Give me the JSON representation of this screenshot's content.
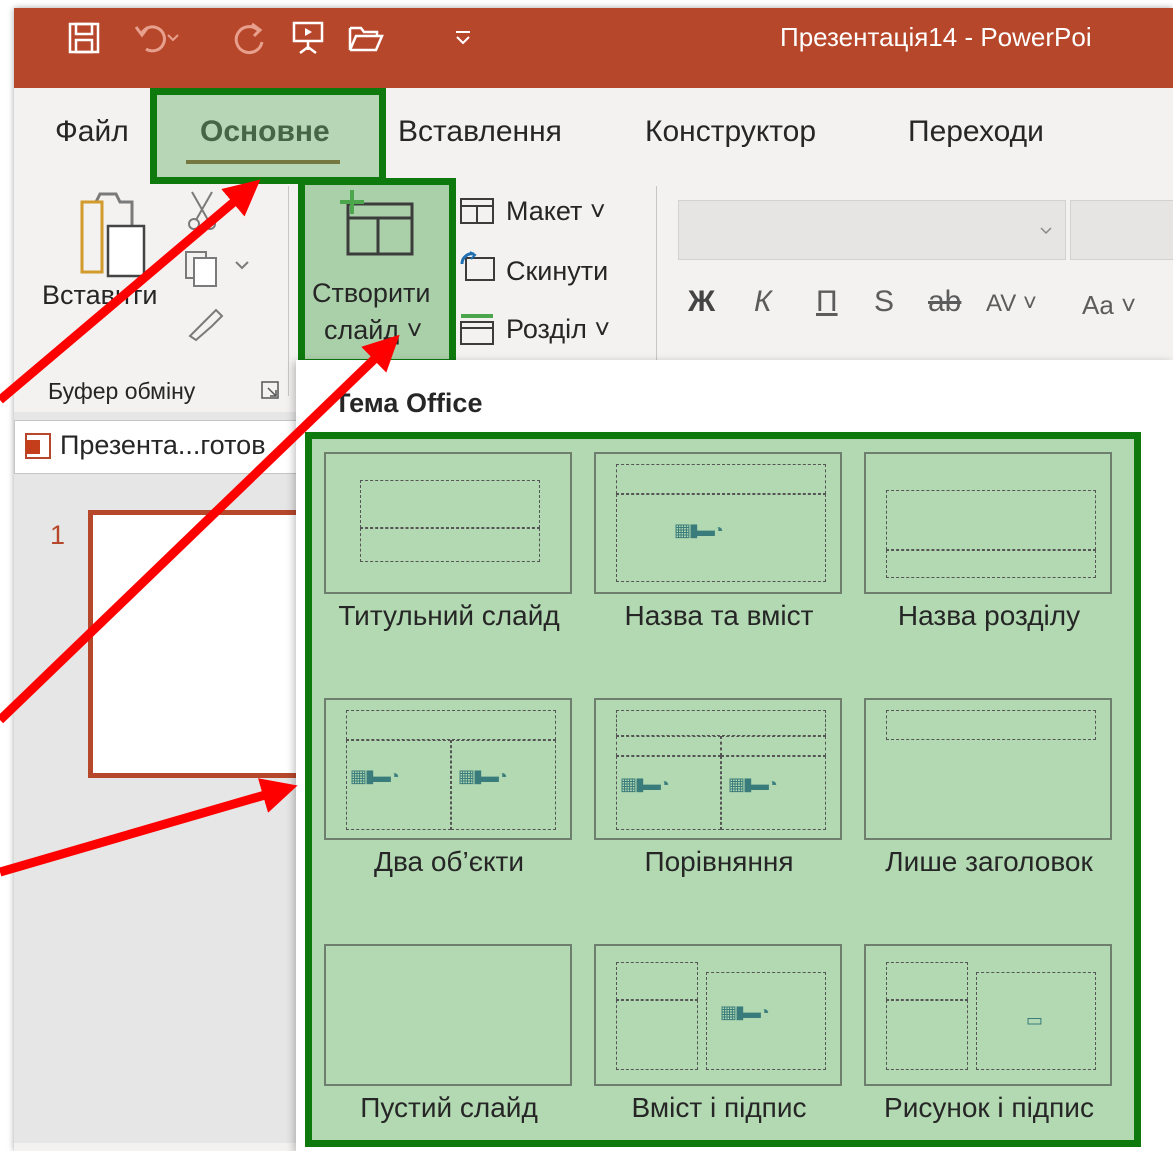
{
  "title_bar": {
    "document_title": "Презентація14  -  PowerPoi"
  },
  "tabs": [
    {
      "label": "Файл"
    },
    {
      "label": "Основне"
    },
    {
      "label": "Вставлення"
    },
    {
      "label": "Конструктор"
    },
    {
      "label": "Переходи"
    }
  ],
  "ribbon": {
    "paste_label": "Вставити",
    "new_slide_label_line1": "Створити",
    "new_slide_label_line2": "слайд ˅",
    "layout_label": "Макет ˅",
    "reset_label": "Скинути",
    "section_label": "Розділ ˅",
    "clipboard_group": "Буфер обміну",
    "format_buttons": [
      "Ж",
      "К",
      "П",
      "S",
      "ab",
      "AV ˅",
      "Aa ˅"
    ]
  },
  "left_pane": {
    "file_tab": "Презента...готов",
    "slide_number": "1"
  },
  "dropdown": {
    "theme_title": "Тема Office",
    "layouts": [
      {
        "name": "Титульний слайд"
      },
      {
        "name": "Назва та вміст"
      },
      {
        "name": "Назва розділу"
      },
      {
        "name": "Два об’єкти"
      },
      {
        "name": "Порівняння"
      },
      {
        "name": "Лише заголовок"
      },
      {
        "name": "Пустий слайд"
      },
      {
        "name": "Вміст і підпис"
      },
      {
        "name": "Рисунок і підпис"
      }
    ]
  },
  "colors": {
    "titlebar": "#b7472a",
    "highlight": "#0e7a0e",
    "gallery_fill": "#b2d9b1",
    "arrow": "#ff0000"
  }
}
